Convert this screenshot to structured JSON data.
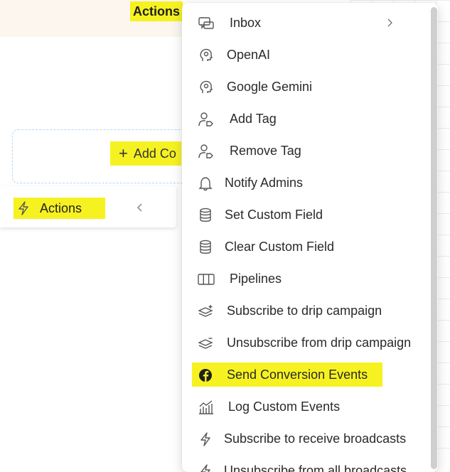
{
  "header": {
    "title": "Actions"
  },
  "canvas": {
    "add_button_label": "Add Co",
    "actions_panel_label": "Actions"
  },
  "menu": {
    "items": [
      {
        "label": "Inbox",
        "icon": "inbox-chat-icon",
        "has_submenu": true
      },
      {
        "label": "OpenAI",
        "icon": "ai-head-icon"
      },
      {
        "label": "Google Gemini",
        "icon": "ai-head-icon"
      },
      {
        "label": "Add Tag",
        "icon": "user-tag-icon"
      },
      {
        "label": "Remove Tag",
        "icon": "user-tag-icon"
      },
      {
        "label": "Notify Admins",
        "icon": "bell-icon"
      },
      {
        "label": "Set Custom Field",
        "icon": "database-icon"
      },
      {
        "label": "Clear Custom Field",
        "icon": "database-icon"
      },
      {
        "label": "Pipelines",
        "icon": "columns-icon"
      },
      {
        "label": "Subscribe to drip campaign",
        "icon": "layers-plus-icon"
      },
      {
        "label": "Unsubscribe from drip campaign",
        "icon": "layers-minus-icon"
      },
      {
        "label": "Send Conversion Events",
        "icon": "facebook-icon",
        "highlighted": true
      },
      {
        "label": "Log Custom Events",
        "icon": "chart-icon"
      },
      {
        "label": "Subscribe to receive broadcasts",
        "icon": "lightning-icon"
      },
      {
        "label": "Unsubscribe from all broadcasts",
        "icon": "lightning-icon"
      }
    ]
  },
  "colors": {
    "highlight": "#f6f221",
    "facebook": "#1f1f1f"
  }
}
